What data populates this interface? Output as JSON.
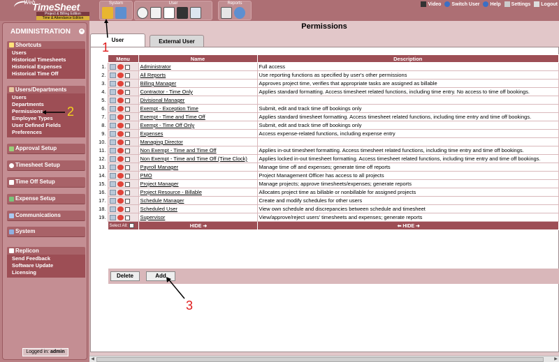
{
  "logo": {
    "web": "Web",
    "name": "TimeSheet",
    "edition1": "Project & Billing Edition",
    "edition2": "Time & Attendance Edition"
  },
  "toolbar": {
    "groups": [
      {
        "title": "System"
      },
      {
        "title": "User"
      },
      {
        "title": "Reports"
      }
    ],
    "links": {
      "video": "Video",
      "switch_user": "Switch User",
      "help": "Help",
      "settings": "Settings",
      "logout": "Logout"
    }
  },
  "sidebar": {
    "title": "ADMINISTRATION",
    "shortcuts": {
      "title": "Shortcuts",
      "items": [
        "Users",
        "Historical Timesheets",
        "Historical Expenses",
        "Historical Time Off"
      ]
    },
    "users_departments": {
      "title": "Users/Departments",
      "items": [
        "Users",
        "Departments",
        "Permissions",
        "Employee Types",
        "User Defined Fields",
        "Preferences"
      ]
    },
    "collapsed": [
      "Approval Setup",
      "Timesheet Setup",
      "Time Off Setup",
      "Expense Setup",
      "Communications",
      "System"
    ],
    "replicon": {
      "title": "Replicon",
      "items": [
        "Send Feedback",
        "Software Update",
        "Licensing"
      ]
    },
    "logged_in_label": "Logged in:",
    "logged_in_user": "admin"
  },
  "main": {
    "title": "Permissions",
    "tabs": [
      "User",
      "External User"
    ],
    "columns": {
      "menu": "Menu",
      "name": "Name",
      "description": "Description"
    },
    "rows": [
      {
        "num": "1.",
        "name": "Administrator",
        "description": "Full access"
      },
      {
        "num": "2.",
        "name": "All Reports",
        "description": "Use reporting functions as specified by user's other permissions"
      },
      {
        "num": "3.",
        "name": "Billing Manager",
        "description": "Approves project time, verifies that appropriate tasks are assigned as billable"
      },
      {
        "num": "4.",
        "name": "Contractor - Time Only",
        "description": "Applies standard formatting. Access timesheet related functions, including time entry. No access to time off bookings."
      },
      {
        "num": "5.",
        "name": "Divisional Manager",
        "description": ""
      },
      {
        "num": "6.",
        "name": "Exempt - Exception Time",
        "description": "Submit, edit and track time off bookings only"
      },
      {
        "num": "7.",
        "name": "Exempt - Time and Time Off",
        "description": "Applies standard timesheet formatting. Access timesheet related functions, including time entry and time off bookings."
      },
      {
        "num": "8.",
        "name": "Exempt - Time Off Only",
        "description": "Submit, edit and track time off bookings only"
      },
      {
        "num": "9.",
        "name": "Expenses",
        "description": "Access expense-related functions, including expense entry"
      },
      {
        "num": "10.",
        "name": "Managing Director",
        "description": ""
      },
      {
        "num": "11.",
        "name": "Non Exempt - Time and Time Off",
        "description": "Applies in-out timesheet formatting. Access timesheet related functions, including time entry and time off bookings."
      },
      {
        "num": "12.",
        "name": "Non Exempt - Time and Time Off (Time Clock)",
        "description": "Applies locked in-out timesheet formatting. Access timesheet related functions, including time entry and time off bookings."
      },
      {
        "num": "13.",
        "name": "Payroll Manager",
        "description": "Manage time off and expenses; generate time off reports"
      },
      {
        "num": "14.",
        "name": "PMO",
        "description": "Project Management Officer has access to all projects"
      },
      {
        "num": "15.",
        "name": "Project Manager",
        "description": "Manage projects; approve timesheets/expenses; generate reports"
      },
      {
        "num": "16.",
        "name": "Project Resource - Billable",
        "description": "Allocates project time as billable or nonbillable for assigned projects"
      },
      {
        "num": "17.",
        "name": "Schedule Manager",
        "description": "Create and modify schedules for other users"
      },
      {
        "num": "18.",
        "name": "Scheduled User",
        "description": "View own schedule and discrepancies between schedule and timesheet"
      },
      {
        "num": "19.",
        "name": "Supervisor",
        "description": "View/approve/reject users' timesheets and expenses; generate reports"
      }
    ],
    "footer": {
      "select_all": "Select All:",
      "hide_right": "HIDE ➜",
      "hide_left": "⬅ HIDE ➜"
    },
    "buttons": {
      "delete": "Delete",
      "add": "Add"
    }
  },
  "annotations": {
    "a1": "1",
    "a2": "2",
    "a3": "3"
  },
  "colors": {
    "header": "#9d4e55",
    "sidebar": "#c48e93",
    "annotation_red": "#e01c1c",
    "annotation_yellow": "#f3d21e"
  }
}
